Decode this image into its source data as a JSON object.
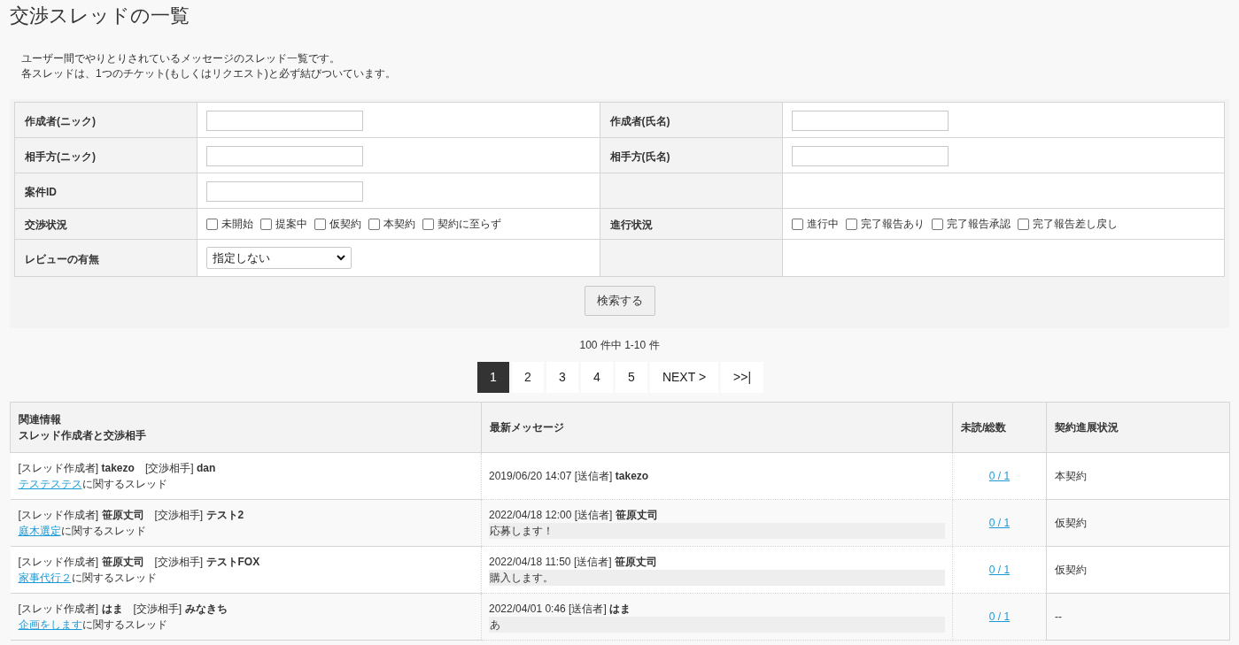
{
  "title": "交渉スレッドの一覧",
  "description": [
    "ユーザー間でやりとりされているメッセージのスレッド一覧です。",
    "各スレッドは、1つのチケット(もしくはリクエスト)と必ず結びついています。"
  ],
  "search_form": {
    "rows": [
      {
        "fields": [
          {
            "label": "作成者(ニック)",
            "kind": "text"
          },
          {
            "label": "作成者(氏名)",
            "kind": "text"
          }
        ]
      },
      {
        "fields": [
          {
            "label": "相手方(ニック)",
            "kind": "text"
          },
          {
            "label": "相手方(氏名)",
            "kind": "text"
          }
        ]
      },
      {
        "fields": [
          {
            "label": "案件ID",
            "kind": "text"
          }
        ]
      },
      {
        "fields": [
          {
            "label": "交渉状況",
            "kind": "checkboxes",
            "options": [
              {
                "label": "未開始",
                "checked": false
              },
              {
                "label": "提案中",
                "checked": false
              },
              {
                "label": "仮契約",
                "checked": false
              },
              {
                "label": "本契約",
                "checked": false
              },
              {
                "label": "契約に至らず",
                "checked": false
              }
            ]
          },
          {
            "label": "進行状況",
            "kind": "checkboxes",
            "options": [
              {
                "label": "進行中",
                "checked": false
              },
              {
                "label": "完了報告あり",
                "checked": false
              },
              {
                "label": "完了報告承認",
                "checked": false
              },
              {
                "label": "完了報告差し戻し",
                "checked": false
              }
            ]
          }
        ]
      },
      {
        "fields": [
          {
            "label": "レビューの有無",
            "kind": "select",
            "value": "指定しない"
          }
        ]
      }
    ],
    "submit": "検索する"
  },
  "result_count": "100 件中 1-10 件",
  "pagination": [
    {
      "label": "1",
      "selected": true
    },
    {
      "label": "2",
      "selected": false
    },
    {
      "label": "3",
      "selected": false
    },
    {
      "label": "4",
      "selected": false
    },
    {
      "label": "5",
      "selected": false
    },
    {
      "label": "NEXT >",
      "selected": false
    },
    {
      "label": ">>|",
      "selected": false
    }
  ],
  "table": {
    "columns": [
      [
        "関連情報",
        "スレッド作成者と交渉相手"
      ],
      [
        "最新メッセージ"
      ],
      [
        "未読/総数"
      ],
      [
        "契約進展状況"
      ]
    ],
    "rows": [
      {
        "creator_label": "[スレッド作成者]",
        "creator": "takezo",
        "partner_label": "[交渉相手]",
        "partner": "dan",
        "link": "テステステス",
        "link_suffix": "に関するスレッド",
        "datetime": "2019/06/20 14:07",
        "sender_label": "[送信者]",
        "sender": "takezo",
        "count": "0 / 1",
        "status": "本契約"
      },
      {
        "creator_label": "[スレッド作成者]",
        "creator": "笹原丈司",
        "partner_label": "[交渉相手]",
        "partner": "テスト2",
        "link": "庭木選定",
        "link_suffix": "に関するスレッド",
        "datetime": "2022/04/18 12:00",
        "sender_label": "[送信者]",
        "sender": "笹原丈司",
        "message": "応募します！",
        "count": "0 / 1",
        "status": "仮契約"
      },
      {
        "creator_label": "[スレッド作成者]",
        "creator": "笹原丈司",
        "partner_label": "[交渉相手]",
        "partner": "テストFOX",
        "link": "家事代行２",
        "link_suffix": "に関するスレッド",
        "datetime": "2022/04/18 11:50",
        "sender_label": "[送信者]",
        "sender": "笹原丈司",
        "message": "購入します。",
        "count": "0 / 1",
        "status": "仮契約"
      },
      {
        "creator_label": "[スレッド作成者]",
        "creator": "はま",
        "partner_label": "[交渉相手]",
        "partner": "みなきち",
        "link": "企画をします",
        "link_suffix": "に関するスレッド",
        "datetime": "2022/04/01 0:46",
        "sender_label": "[送信者]",
        "sender": "はま",
        "message": "あ",
        "count": "0 / 1",
        "status": "--"
      }
    ]
  }
}
